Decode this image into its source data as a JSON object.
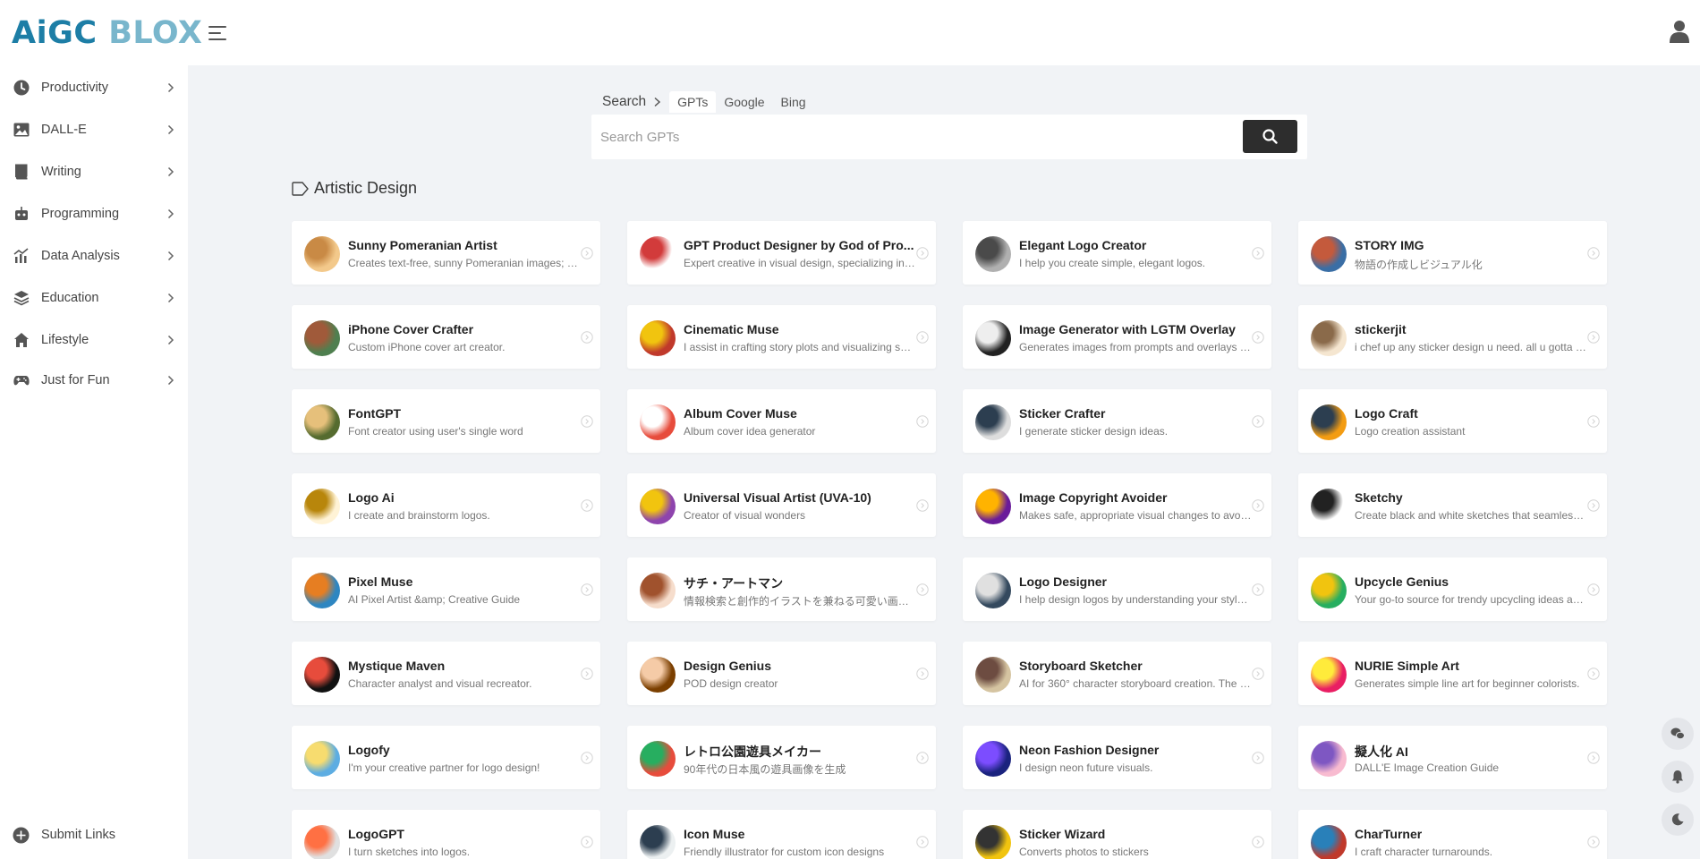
{
  "header": {
    "logo_part1": "AiGC",
    "logo_part2": "BLOX"
  },
  "sidebar": {
    "items": [
      {
        "label": "Productivity",
        "icon": "clock-icon"
      },
      {
        "label": "DALL-E",
        "icon": "image-icon"
      },
      {
        "label": "Writing",
        "icon": "book-icon"
      },
      {
        "label": "Programming",
        "icon": "robot-icon"
      },
      {
        "label": "Data Analysis",
        "icon": "chart-icon"
      },
      {
        "label": "Education",
        "icon": "layers-icon"
      },
      {
        "label": "Lifestyle",
        "icon": "home-icon"
      },
      {
        "label": "Just for Fun",
        "icon": "gamepad-icon"
      }
    ],
    "submit_label": "Submit Links"
  },
  "search": {
    "root_label": "Search",
    "tabs": [
      "GPTs",
      "Google",
      "Bing"
    ],
    "active_tab": "GPTs",
    "placeholder": "Search GPTs"
  },
  "section": {
    "title": "Artistic Design"
  },
  "cards": [
    {
      "title": "Sunny Pomeranian Artist",
      "desc": "Creates text-free, sunny Pomeranian images; co..."
    },
    {
      "title": "GPT Product Designer by God of Pro...",
      "desc": "Expert creative in visual design, specializing in c..."
    },
    {
      "title": "Elegant Logo Creator",
      "desc": "I help you create simple, elegant logos."
    },
    {
      "title": "STORY IMG",
      "desc": "物語の作成しビジュアル化"
    },
    {
      "title": "iPhone Cover Crafter",
      "desc": "Custom iPhone cover art creator."
    },
    {
      "title": "Cinematic Muse",
      "desc": "I assist in crafting story plots and visualizing sce..."
    },
    {
      "title": "Image Generator with LGTM Overlay",
      "desc": "Generates images from prompts and overlays 'L..."
    },
    {
      "title": "stickerjit",
      "desc": "i chef up any sticker design u need. all u gotta d..."
    },
    {
      "title": "FontGPT",
      "desc": "Font creator using user's single word"
    },
    {
      "title": "Album Cover Muse",
      "desc": "Album cover idea generator"
    },
    {
      "title": "Sticker Crafter",
      "desc": "I generate sticker design ideas."
    },
    {
      "title": "Logo Craft",
      "desc": "Logo creation assistant"
    },
    {
      "title": "Logo Ai",
      "desc": "I create and brainstorm logos."
    },
    {
      "title": "Universal Visual Artist (UVA-10)",
      "desc": "Creator of visual wonders"
    },
    {
      "title": "Image Copyright Avoider",
      "desc": "Makes safe, appropriate visual changes to avoid..."
    },
    {
      "title": "Sketchy",
      "desc": "Create black and white sketches that seamlessly..."
    },
    {
      "title": "Pixel Muse",
      "desc": "AI Pixel Artist &amp; Creative Guide"
    },
    {
      "title": "サチ・アートマン",
      "desc": "情報検索と創作的イラストを兼ねる可愛い画家..."
    },
    {
      "title": "Logo Designer",
      "desc": "I help design logos by understanding your style..."
    },
    {
      "title": "Upcycle Genius",
      "desc": "Your go-to source for trendy upcycling ideas an..."
    },
    {
      "title": "Mystique Maven",
      "desc": "Character analyst and visual recreator."
    },
    {
      "title": "Design Genius",
      "desc": "POD design creator"
    },
    {
      "title": "Storyboard Sketcher",
      "desc": "AI for 360° character storyboard creation. The p..."
    },
    {
      "title": "NURIE Simple Art",
      "desc": "Generates simple line art for beginner colorists."
    },
    {
      "title": "Logofy",
      "desc": "I'm your creative partner for logo design!"
    },
    {
      "title": "レトロ公園遊具メイカー",
      "desc": "90年代の日本風の遊具画像を生成"
    },
    {
      "title": "Neon Fashion Designer",
      "desc": "I design neon future visuals."
    },
    {
      "title": "擬人化 AI",
      "desc": "DALL'E Image Creation Guide"
    },
    {
      "title": "LogoGPT",
      "desc": "I turn sketches into logos."
    },
    {
      "title": "Icon Muse",
      "desc": "Friendly illustrator for custom icon designs"
    },
    {
      "title": "Sticker Wizard",
      "desc": "Converts photos to stickers"
    },
    {
      "title": "CharTurner",
      "desc": "I craft character turnarounds."
    }
  ],
  "colors": {
    "brand_dark": "#1d7ea6",
    "brand_light": "#79b6cc",
    "search_button": "#2d2d2d",
    "page_bg": "#f1f3f6"
  }
}
